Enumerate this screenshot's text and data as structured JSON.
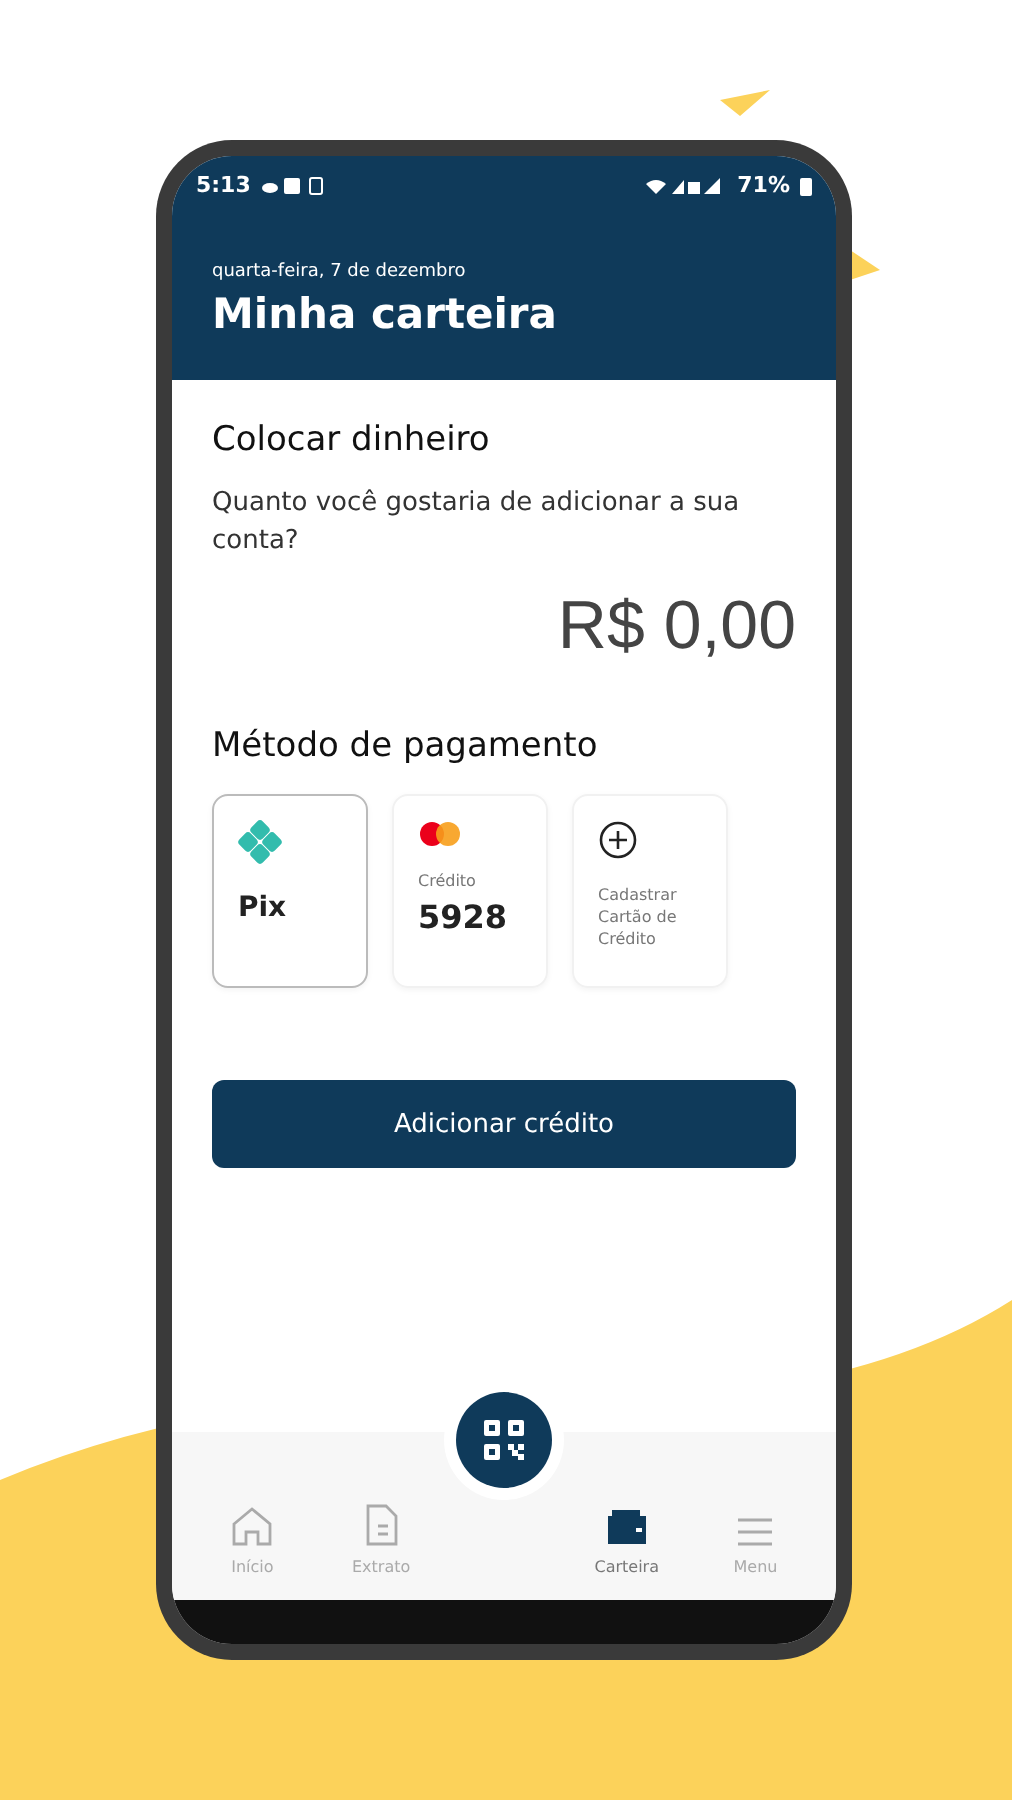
{
  "status_bar": {
    "time": "5:13",
    "battery": "71%"
  },
  "header": {
    "date": "quarta-feira, 7 de dezembro",
    "title": "Minha carteira"
  },
  "deposit": {
    "title": "Colocar dinheiro",
    "question": "Quanto você gostaria de adicionar a sua conta?",
    "amount": "R$ 0,00"
  },
  "payment": {
    "title": "Método de pagamento",
    "methods": [
      {
        "kind": "pix",
        "label": "Pix",
        "selected": true
      },
      {
        "kind": "card",
        "caption": "Crédito",
        "label": "5928",
        "selected": false
      },
      {
        "kind": "add",
        "label": "Cadastrar Cartão de Crédito",
        "selected": false
      }
    ]
  },
  "action_button": "Adicionar crédito",
  "nav": {
    "items": [
      {
        "kind": "home",
        "label": "Início",
        "selected": false
      },
      {
        "kind": "document",
        "label": "Extrato",
        "selected": false
      },
      {
        "kind": "qr",
        "selected": false
      },
      {
        "kind": "wallet",
        "label": "Carteira",
        "selected": true
      },
      {
        "kind": "menu",
        "label": "Menu",
        "selected": false
      }
    ]
  }
}
